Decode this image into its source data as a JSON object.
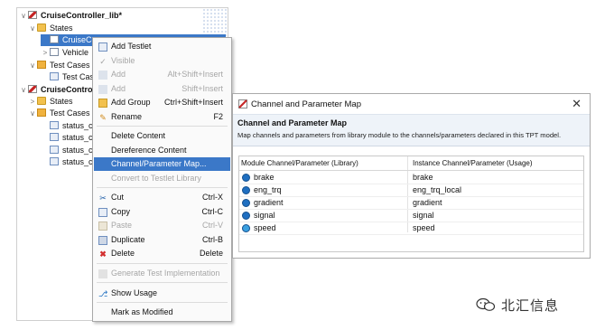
{
  "tree": {
    "items": [
      {
        "label": "CruiseController_lib*",
        "icon": "library-icon",
        "bold": true
      },
      {
        "label": "States",
        "icon": "folder-icon"
      },
      {
        "label": "CruiseCo",
        "icon": "model-icon",
        "selected": true
      },
      {
        "label": "Vehicle",
        "icon": "model-icon"
      },
      {
        "label": "Test Cases [",
        "icon": "testcase-folder-icon"
      },
      {
        "label": "Test Cas",
        "icon": "testcase-icon"
      },
      {
        "label": "CruiseControl",
        "icon": "library-icon",
        "bold": true
      },
      {
        "label": "States",
        "icon": "folder-icon"
      },
      {
        "label": "Test Cases [",
        "icon": "testcase-folder-icon"
      },
      {
        "label": "status_cc",
        "icon": "test-file-icon"
      },
      {
        "label": "status_cc",
        "icon": "test-file-icon"
      },
      {
        "label": "status_cc",
        "icon": "test-file-icon"
      },
      {
        "label": "status_cc",
        "icon": "test-file-icon"
      }
    ]
  },
  "menu": {
    "items": [
      {
        "label": "Add Testlet",
        "shortcut": "",
        "icon": "add-testlet-icon",
        "disabled": false
      },
      {
        "label": "Visible",
        "shortcut": "",
        "icon": "check-icon",
        "disabled": true
      },
      {
        "label": "Add",
        "shortcut": "Alt+Shift+Insert",
        "icon": "",
        "disabled": true
      },
      {
        "label": "Add",
        "shortcut": "Shift+Insert",
        "icon": "",
        "disabled": true
      },
      {
        "label": "Add Group",
        "shortcut": "Ctrl+Shift+Insert",
        "icon": "add-group-icon",
        "disabled": false
      },
      {
        "label": "Rename",
        "shortcut": "F2",
        "icon": "pencil-icon",
        "disabled": false
      },
      {
        "label": "Delete Content",
        "shortcut": "",
        "icon": "",
        "disabled": false
      },
      {
        "label": "Dereference Content",
        "shortcut": "",
        "icon": "",
        "disabled": false
      },
      {
        "label": "Channel/Parameter Map...",
        "shortcut": "",
        "icon": "",
        "disabled": false,
        "highlighted": true
      },
      {
        "label": "Convert to Testlet Library",
        "shortcut": "",
        "icon": "",
        "disabled": true
      },
      {
        "label": "Cut",
        "shortcut": "Ctrl-X",
        "icon": "scissors-icon",
        "disabled": false
      },
      {
        "label": "Copy",
        "shortcut": "Ctrl-C",
        "icon": "copy-icon",
        "disabled": false
      },
      {
        "label": "Paste",
        "shortcut": "Ctrl-V",
        "icon": "paste-icon",
        "disabled": true
      },
      {
        "label": "Duplicate",
        "shortcut": "Ctrl-B",
        "icon": "duplicate-icon",
        "disabled": false
      },
      {
        "label": "Delete",
        "shortcut": "Delete",
        "icon": "delete-icon",
        "disabled": false
      },
      {
        "label": "Generate Test Implementation",
        "shortcut": "",
        "icon": "",
        "disabled": true
      },
      {
        "label": "Show Usage",
        "shortcut": "",
        "icon": "usage-icon",
        "disabled": false
      },
      {
        "label": "Mark as Modified",
        "shortcut": "",
        "icon": "",
        "disabled": false
      }
    ]
  },
  "dialog": {
    "title": "Channel and Parameter Map",
    "header_title": "Channel and Parameter Map",
    "header_desc": "Map channels and parameters from library module to the channels/parameters declared in this TPT model.",
    "columns": [
      "Module Channel/Parameter (Library)",
      "Instance Channel/Parameter (Usage)"
    ],
    "rows": [
      {
        "module": "brake",
        "instance": "brake"
      },
      {
        "module": "eng_trq",
        "instance": "eng_trq_local"
      },
      {
        "module": "gradient",
        "instance": "gradient"
      },
      {
        "module": "signal",
        "instance": "signal"
      },
      {
        "module": "speed",
        "instance": "speed"
      }
    ]
  },
  "watermark": {
    "text": "北汇信息",
    "icon": "wechat-icon"
  },
  "colors": {
    "selection": "#3b78c8",
    "disabled": "#a6a6a6",
    "header_bg": "#eef3f9"
  }
}
